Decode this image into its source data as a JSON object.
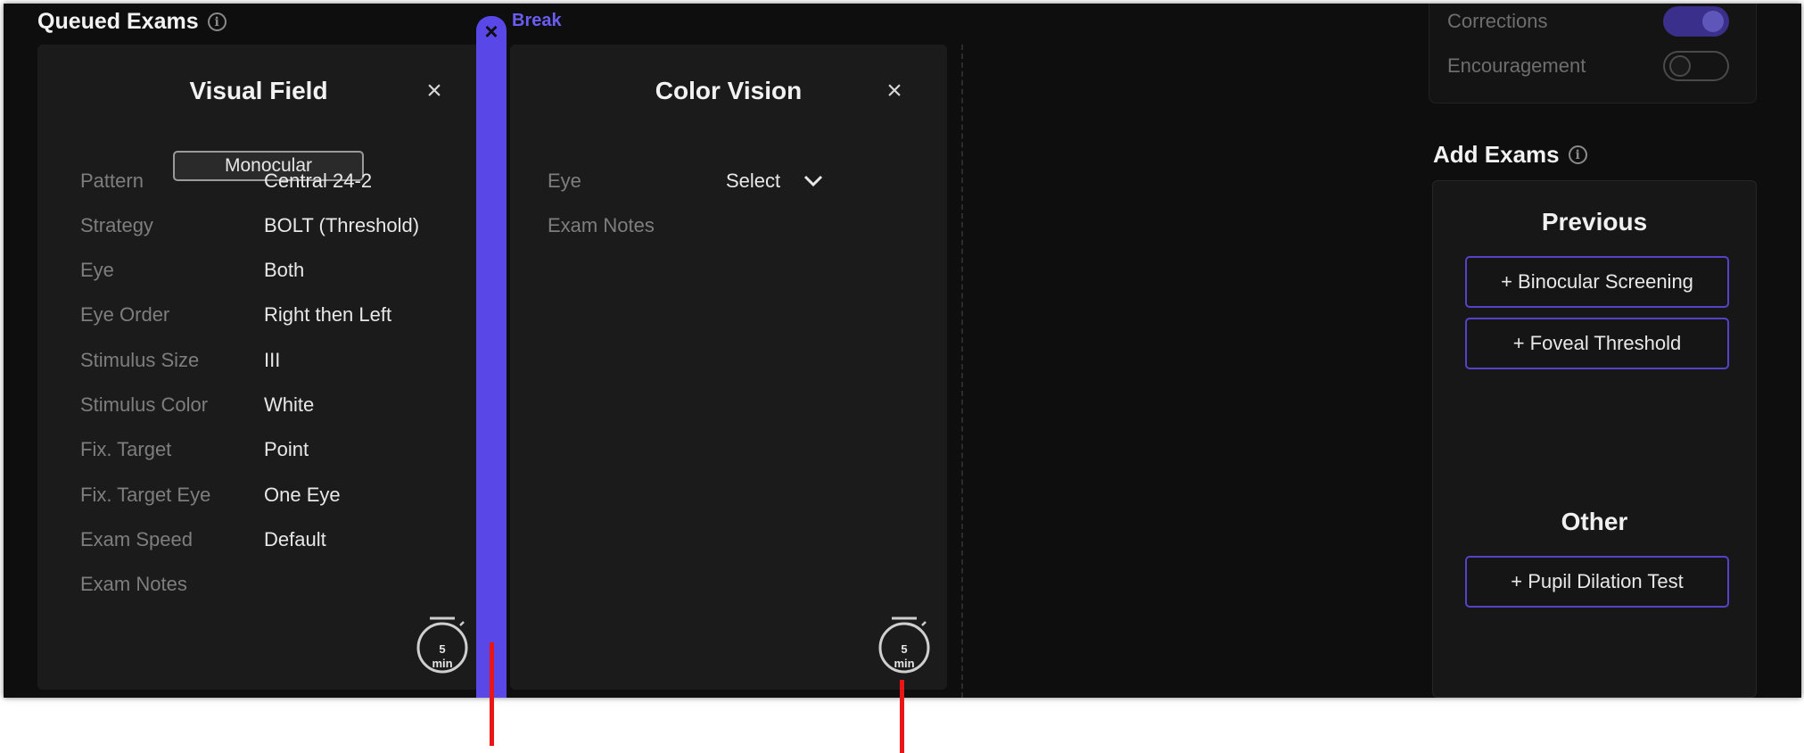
{
  "queued": {
    "title": "Queued Exams",
    "info_icon": "i"
  },
  "visual_field": {
    "title": "Visual Field",
    "close": "×",
    "badge": "Monocular",
    "fields": [
      {
        "label": "Pattern",
        "value": "Central 24-2"
      },
      {
        "label": "Strategy",
        "value": "BOLT (Threshold)"
      },
      {
        "label": "Eye",
        "value": "Both"
      },
      {
        "label": "Eye Order",
        "value": "Right then Left"
      },
      {
        "label": "Stimulus Size",
        "value": "III"
      },
      {
        "label": "Stimulus Color",
        "value": "White"
      },
      {
        "label": "Fix. Target",
        "value": "Point"
      },
      {
        "label": "Fix. Target Eye",
        "value": "One Eye"
      },
      {
        "label": "Exam Speed",
        "value": "Default"
      },
      {
        "label": "Exam Notes",
        "value": ""
      }
    ],
    "timer": {
      "value": "5",
      "unit": "min"
    }
  },
  "break": {
    "label": "Break",
    "close": "×"
  },
  "color_vision": {
    "title": "Color Vision",
    "close": "×",
    "eye_label": "Eye",
    "eye_value": "Select",
    "notes_label": "Exam Notes",
    "timer": {
      "value": "5",
      "unit": "min"
    }
  },
  "settings": {
    "corrections_label": "Corrections",
    "corrections_on": true,
    "encouragement_label": "Encouragement",
    "encouragement_on": false
  },
  "add_exams": {
    "title": "Add Exams",
    "info_icon": "i",
    "previous_title": "Previous",
    "previous_buttons": [
      "+ Binocular Screening",
      "+ Foveal Threshold"
    ],
    "other_title": "Other",
    "other_buttons": [
      "+ Pupil Dilation Test"
    ]
  },
  "colors": {
    "accent": "#5a47e8",
    "background": "#0e0e0e",
    "card": "#1b1b1b",
    "annotation": "#e81616"
  }
}
